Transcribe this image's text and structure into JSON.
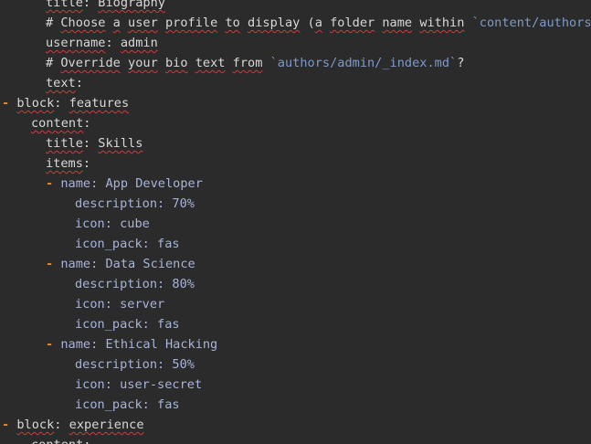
{
  "colors": {
    "background": "#2b2b2b",
    "text": "#d8d8d8",
    "list_dash": "#e08a34",
    "value": "#a8b4d8",
    "inline_code": "#7e9ac9",
    "spellcheck": "#d9363e"
  },
  "lines": [
    {
      "indent": 3,
      "tokens": [
        {
          "t": "title",
          "c": "text",
          "sq": true
        },
        {
          "t": ": ",
          "c": "punct"
        },
        {
          "t": "Biography",
          "c": "text",
          "sq": true
        }
      ]
    },
    {
      "indent": 3,
      "tokens": [
        {
          "t": "# ",
          "c": "text"
        },
        {
          "t": "Choose",
          "c": "text",
          "sq": true
        },
        {
          "t": " ",
          "c": "text"
        },
        {
          "t": "a",
          "c": "text",
          "sq": true
        },
        {
          "t": " ",
          "c": "text"
        },
        {
          "t": "user",
          "c": "text",
          "sq": true
        },
        {
          "t": " ",
          "c": "text"
        },
        {
          "t": "profile",
          "c": "text",
          "sq": true
        },
        {
          "t": " ",
          "c": "text"
        },
        {
          "t": "to",
          "c": "text",
          "sq": true
        },
        {
          "t": " ",
          "c": "text"
        },
        {
          "t": "display",
          "c": "text",
          "sq": true
        },
        {
          "t": " (",
          "c": "text"
        },
        {
          "t": "a",
          "c": "text",
          "sq": true
        },
        {
          "t": " ",
          "c": "text"
        },
        {
          "t": "folder",
          "c": "text",
          "sq": true
        },
        {
          "t": " ",
          "c": "text"
        },
        {
          "t": "name",
          "c": "text",
          "sq": true
        },
        {
          "t": " ",
          "c": "text"
        },
        {
          "t": "within",
          "c": "text",
          "sq": true
        },
        {
          "t": " ",
          "c": "text"
        },
        {
          "t": "`content/authors/`",
          "c": "code"
        }
      ]
    },
    {
      "indent": 3,
      "tokens": [
        {
          "t": "username",
          "c": "text",
          "sq": true
        },
        {
          "t": ": ",
          "c": "punct"
        },
        {
          "t": "admin",
          "c": "text",
          "sq": true
        }
      ]
    },
    {
      "indent": 3,
      "tokens": [
        {
          "t": "# ",
          "c": "text"
        },
        {
          "t": "Override",
          "c": "text",
          "sq": true
        },
        {
          "t": " ",
          "c": "text"
        },
        {
          "t": "your",
          "c": "text",
          "sq": true
        },
        {
          "t": " ",
          "c": "text"
        },
        {
          "t": "bio",
          "c": "text",
          "sq": true
        },
        {
          "t": " ",
          "c": "text"
        },
        {
          "t": "text",
          "c": "text",
          "sq": true
        },
        {
          "t": " ",
          "c": "text"
        },
        {
          "t": "from",
          "c": "text",
          "sq": true
        },
        {
          "t": " ",
          "c": "text"
        },
        {
          "t": "`authors/admin/_index.md`",
          "c": "code"
        },
        {
          "t": "?",
          "c": "text"
        }
      ]
    },
    {
      "indent": 3,
      "tokens": [
        {
          "t": "text",
          "c": "text",
          "sq": true
        },
        {
          "t": ":",
          "c": "punct"
        }
      ]
    },
    {
      "indent": 1,
      "dash": "- ",
      "tokens": [
        {
          "t": "block",
          "c": "text",
          "sq": true
        },
        {
          "t": ": ",
          "c": "punct"
        },
        {
          "t": "features",
          "c": "text",
          "sq": true
        }
      ]
    },
    {
      "indent": 2,
      "tokens": [
        {
          "t": "content",
          "c": "text",
          "sq": true
        },
        {
          "t": ":",
          "c": "punct"
        }
      ]
    },
    {
      "indent": 3,
      "tokens": [
        {
          "t": "title",
          "c": "text",
          "sq": true
        },
        {
          "t": ": ",
          "c": "punct"
        },
        {
          "t": "Skills",
          "c": "text",
          "sq": true
        }
      ]
    },
    {
      "indent": 3,
      "tokens": [
        {
          "t": "items",
          "c": "text",
          "sq": true
        },
        {
          "t": ":",
          "c": "punct"
        }
      ]
    },
    {
      "indent": 4,
      "dash": "- ",
      "tokens": [
        {
          "t": "name: App Developer",
          "c": "value"
        }
      ]
    },
    {
      "indent": 5,
      "tokens": [
        {
          "t": "description: 70%",
          "c": "value"
        }
      ]
    },
    {
      "indent": 5,
      "tokens": [
        {
          "t": "icon: cube",
          "c": "value"
        }
      ]
    },
    {
      "indent": 5,
      "tokens": [
        {
          "t": "icon_pack: fas",
          "c": "value"
        }
      ]
    },
    {
      "indent": 4,
      "dash": "- ",
      "tokens": [
        {
          "t": "name: Data Science",
          "c": "value"
        }
      ]
    },
    {
      "indent": 5,
      "tokens": [
        {
          "t": "description: 80%",
          "c": "value"
        }
      ]
    },
    {
      "indent": 5,
      "tokens": [
        {
          "t": "icon: server",
          "c": "value"
        }
      ]
    },
    {
      "indent": 5,
      "tokens": [
        {
          "t": "icon_pack: fas",
          "c": "value"
        }
      ]
    },
    {
      "indent": 4,
      "dash": "- ",
      "tokens": [
        {
          "t": "name: Ethical Hacking",
          "c": "value"
        }
      ]
    },
    {
      "indent": 5,
      "tokens": [
        {
          "t": "description: 50%",
          "c": "value"
        }
      ]
    },
    {
      "indent": 5,
      "tokens": [
        {
          "t": "icon: user-secret",
          "c": "value"
        }
      ]
    },
    {
      "indent": 5,
      "tokens": [
        {
          "t": "icon_pack: fas",
          "c": "value"
        }
      ]
    },
    {
      "indent": 1,
      "dash": "- ",
      "tokens": [
        {
          "t": "block",
          "c": "text",
          "sq": true
        },
        {
          "t": ": ",
          "c": "punct"
        },
        {
          "t": "experience",
          "c": "text",
          "sq": true
        }
      ]
    },
    {
      "indent": 2,
      "tokens": [
        {
          "t": "content",
          "c": "text",
          "sq": true
        },
        {
          "t": ":",
          "c": "punct"
        }
      ]
    }
  ]
}
